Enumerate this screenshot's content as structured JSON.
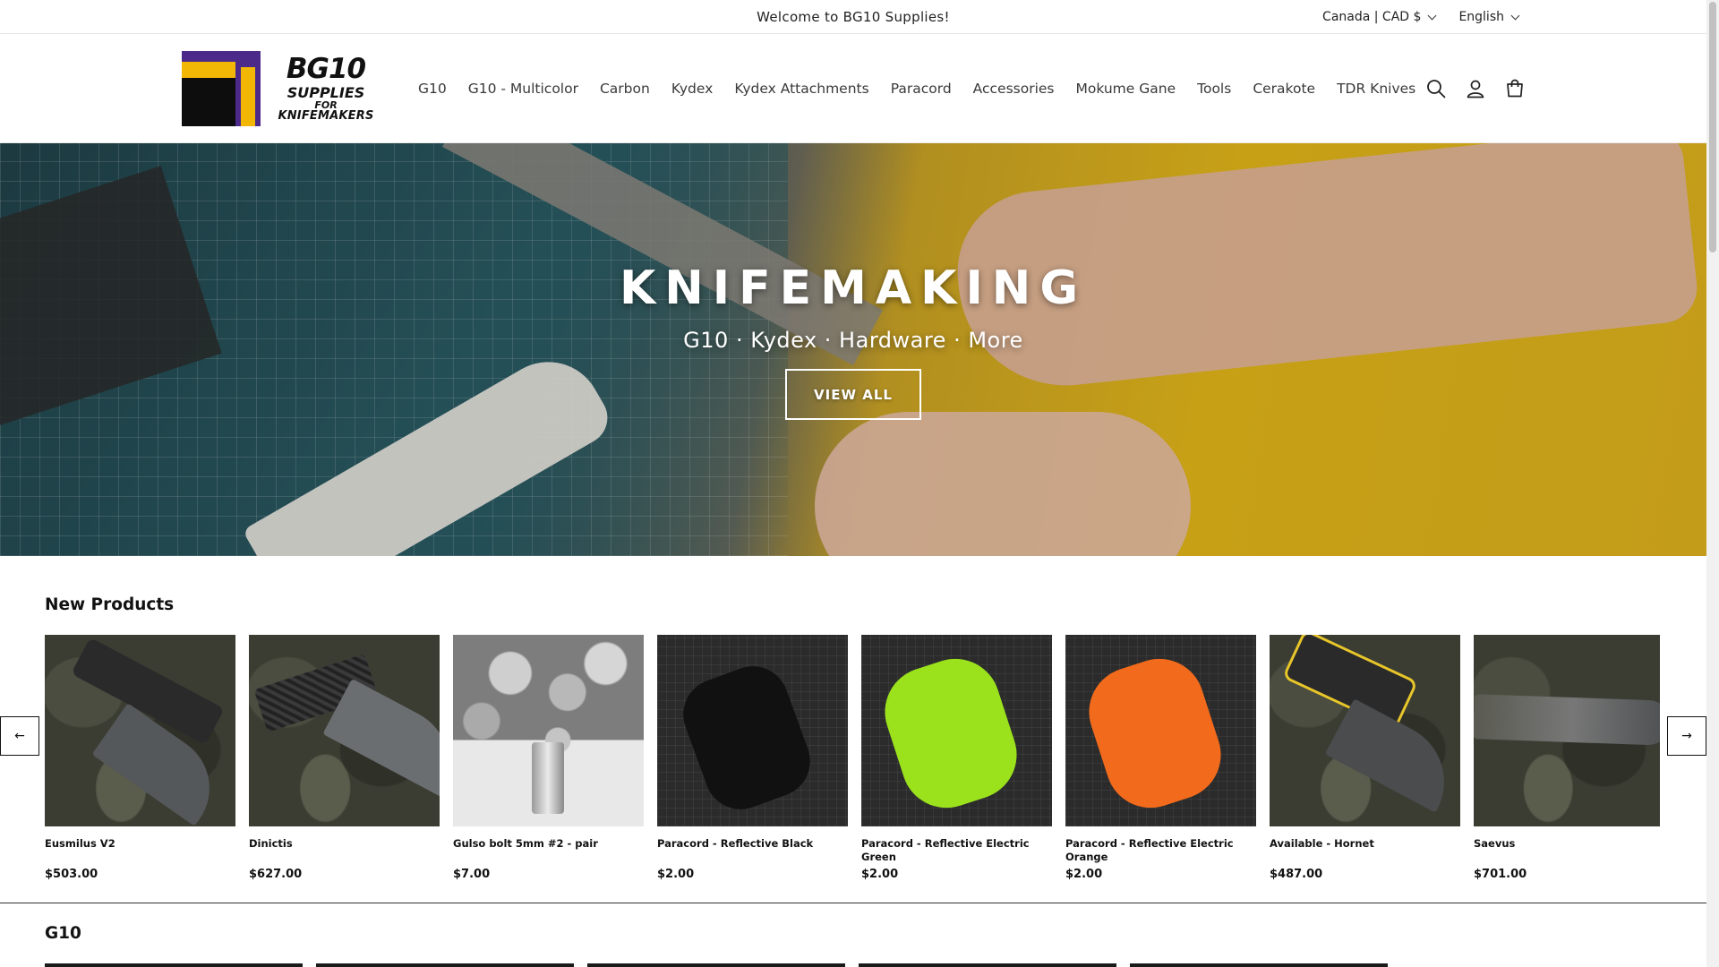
{
  "announcement": {
    "text": "Welcome to BG10 Supplies!"
  },
  "localization": {
    "country": "Canada | CAD $",
    "language": "English"
  },
  "logo": {
    "line1": "BG10",
    "line2": "SUPPLIES",
    "line3": "FOR",
    "line4": "KNIFEMAKERS"
  },
  "nav": {
    "items": [
      "G10",
      "G10 - Multicolor",
      "Carbon",
      "Kydex",
      "Kydex Attachments",
      "Paracord",
      "Accessories",
      "Mokume Gane",
      "Tools",
      "Cerakote",
      "TDR Knives"
    ]
  },
  "header_icons": [
    "search-icon",
    "account-icon",
    "cart-icon"
  ],
  "hero": {
    "title": "KNIFEMAKING",
    "subtitle": "G10 · Kydex · Hardware · More",
    "button_label": "VIEW ALL"
  },
  "new_products": {
    "title": "New Products",
    "prev_label": "←",
    "next_label": "→",
    "items": [
      {
        "name": "Eusmilus V2",
        "price": "$503.00"
      },
      {
        "name": "Dinictis",
        "price": "$627.00"
      },
      {
        "name": "Gulso bolt 5mm #2 - pair",
        "price": "$7.00"
      },
      {
        "name": "Paracord - Reflective Black",
        "price": "$2.00"
      },
      {
        "name": "Paracord - Reflective Electric Green",
        "price": "$2.00"
      },
      {
        "name": "Paracord - Reflective Electric Orange",
        "price": "$2.00"
      },
      {
        "name": "Available - Hornet",
        "price": "$487.00"
      },
      {
        "name": "Saevus",
        "price": "$701.00"
      }
    ]
  },
  "g10_section": {
    "title": "G10"
  },
  "colors": {
    "accent": "#121212",
    "hero_yellow": "#e3b71a",
    "mat_teal": "#24535c",
    "logo_purple": "#4b2a8a",
    "logo_yellow": "#f2b705"
  }
}
